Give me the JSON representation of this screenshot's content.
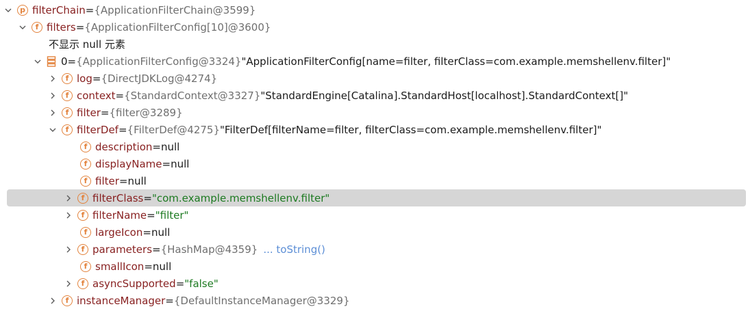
{
  "rows": [
    {
      "name": "filterChain",
      "eq": " = ",
      "ref": "{ApplicationFilterChain@3599}",
      "icon": "p"
    },
    {
      "name": "filters",
      "eq": " = ",
      "ref": "{ApplicationFilterConfig[10]@3600}",
      "icon": "f"
    },
    {
      "text": "不显示 null 元素"
    },
    {
      "name": "0",
      "eq": " = ",
      "ref": "{ApplicationFilterConfig@3324}",
      "str": " \"ApplicationFilterConfig[name=filter, filterClass=com.example.memshellenv.filter]\""
    },
    {
      "name": "log",
      "eq": " = ",
      "ref": "{DirectJDKLog@4274}"
    },
    {
      "name": "context",
      "eq": " = ",
      "ref": "{StandardContext@3327}",
      "str": " \"StandardEngine[Catalina].StandardHost[localhost].StandardContext[]\""
    },
    {
      "name": "filter",
      "eq": " = ",
      "ref": "{filter@3289}"
    },
    {
      "name": "filterDef",
      "eq": " = ",
      "ref": "{FilterDef@4275}",
      "str": " \"FilterDef[filterName=filter, filterClass=com.example.memshellenv.filter]\""
    },
    {
      "name": "description",
      "eq": " = ",
      "val": "null"
    },
    {
      "name": "displayName",
      "eq": " = ",
      "val": "null"
    },
    {
      "name": "filter",
      "eq": " = ",
      "val": "null"
    },
    {
      "name": "filterClass",
      "eq": " = ",
      "green": "\"com.example.memshellenv.filter\""
    },
    {
      "name": "filterName",
      "eq": " = ",
      "green": "\"filter\""
    },
    {
      "name": "largeIcon",
      "eq": " = ",
      "val": "null"
    },
    {
      "name": "parameters",
      "eq": " = ",
      "ref": "{HashMap@4359}",
      "link": "... toString()"
    },
    {
      "name": "smallIcon",
      "eq": " = ",
      "val": "null"
    },
    {
      "name": "asyncSupported",
      "eq": " = ",
      "green": "\"false\""
    },
    {
      "name": "instanceManager",
      "eq": " = ",
      "ref": "{DefaultInstanceManager@3329}"
    }
  ],
  "colors": {
    "field_icon": "#e3833d",
    "field_name": "#871f1f",
    "reference": "#6f6f6f",
    "string_value": "#1d7a21",
    "link": "#5d8fd6",
    "selection": "#d6d6d6"
  }
}
